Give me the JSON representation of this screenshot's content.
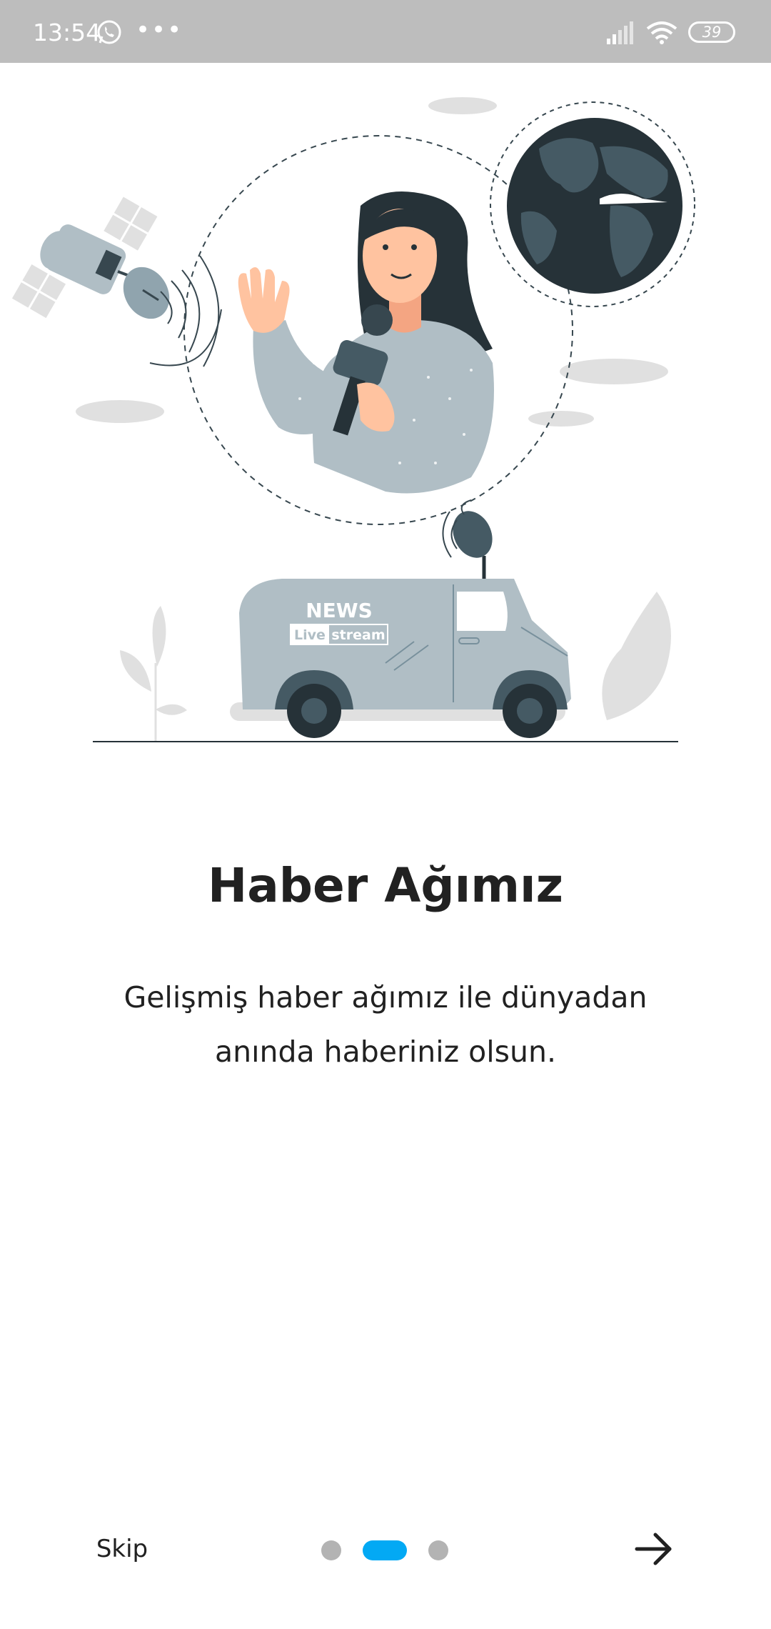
{
  "status_bar": {
    "time": "13:54",
    "more_indicator": "•••",
    "battery": "39",
    "icons": [
      "whatsapp-icon",
      "signal-icon",
      "wifi-icon",
      "battery-icon"
    ]
  },
  "onboarding": {
    "illustration": "news-reporter-illustration",
    "van_news_label": "NEWS",
    "van_live_label": "Live",
    "van_stream_label": "stream",
    "title": "Haber Ağımız",
    "description": "Gelişmiş haber ağımız ile dünyadan anında haberiniz olsun.",
    "page_count": 3,
    "current_page": 2
  },
  "footer": {
    "skip_label": "Skip",
    "next_icon": "arrow-right-icon"
  },
  "colors": {
    "status_bar": "#bdbdbd",
    "accent": "#03a9f4",
    "inactive_dot": "#b3b3b3",
    "text": "#212121",
    "illustration_dark": "#263238",
    "illustration_gray": "#b0bec5"
  }
}
